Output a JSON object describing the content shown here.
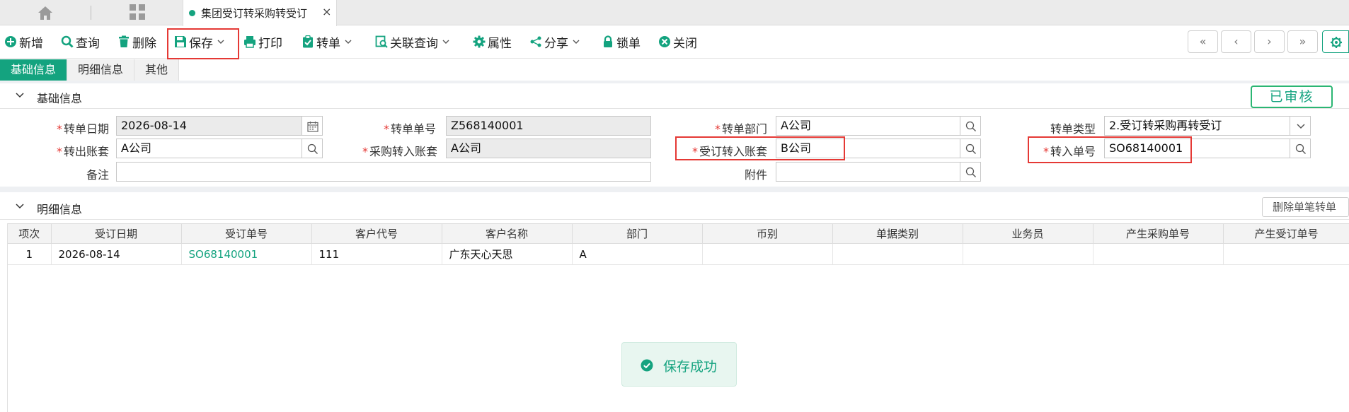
{
  "tabbar": {
    "doc_tab_title": "集团受订转采购转受订",
    "close_glyph": "×"
  },
  "toolbar": {
    "add": "新增",
    "query": "查询",
    "delete": "删除",
    "save": "保存",
    "print": "打印",
    "transfer": "转单",
    "related_query": "关联查询",
    "property": "属性",
    "share": "分享",
    "lock": "锁单",
    "close": "关闭",
    "nav_first": "«",
    "nav_prev": "‹",
    "nav_next": "›",
    "nav_last": "»"
  },
  "subtabs": [
    "基础信息",
    "明细信息",
    "其他"
  ],
  "sections": {
    "basic": "基础信息",
    "detail": "明细信息"
  },
  "status": "已审核",
  "form": {
    "transfer_date_label": "转单日期",
    "transfer_date": "2026-08-14",
    "transfer_no_label": "转单单号",
    "transfer_no": "Z568140001",
    "transfer_dept_label": "转单部门",
    "transfer_dept": "A公司",
    "transfer_type_label": "转单类型",
    "transfer_type": "2.受订转采购再转受订",
    "out_account_label": "转出账套",
    "out_account": "A公司",
    "purchase_in_account_label": "采购转入账套",
    "purchase_in_account": "A公司",
    "order_in_account_label": "受订转入账套",
    "order_in_account": "B公司",
    "in_no_label": "转入单号",
    "in_no": "SO68140001",
    "remark_label": "备注",
    "remark": "",
    "attachment_label": "附件",
    "attachment": "",
    "required_mark": "*"
  },
  "detail": {
    "delete_line_button": "删除单笔转单",
    "columns": [
      "项次",
      "受订日期",
      "受订单号",
      "客户代号",
      "客户名称",
      "部门",
      "币别",
      "单据类别",
      "业务员",
      "产生采购单号",
      "产生受订单号"
    ],
    "rows": [
      [
        "1",
        "2026-08-14",
        "SO68140001",
        "111",
        "广东天心天思",
        "A",
        "",
        "",
        "",
        "",
        ""
      ]
    ]
  },
  "toast": "保存成功",
  "colors": {
    "accent": "#14a37f",
    "highlight": "#e53935"
  }
}
